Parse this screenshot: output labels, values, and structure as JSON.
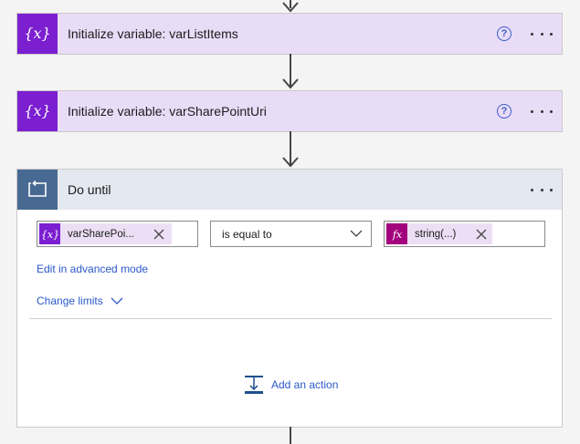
{
  "steps": [
    {
      "title": "Initialize variable: varListItems",
      "icon": "variable-icon"
    },
    {
      "title": "Initialize variable: varSharePointUri",
      "icon": "variable-icon"
    }
  ],
  "help_glyph": "?",
  "do_until": {
    "title": "Do until",
    "icon": "loop-icon",
    "condition": {
      "left_token": "varSharePoi...",
      "operator": "is equal to",
      "right_token": "string(...)"
    },
    "advanced_mode_link": "Edit in advanced mode",
    "change_limits_link": "Change limits",
    "add_action_label": "Add an action"
  },
  "colors": {
    "variable_accent": "#7b1fd1",
    "variable_header": "#e9dcf7",
    "loop_accent": "#486991",
    "loop_header": "#e4e8f0",
    "expression_accent": "#a3007d",
    "token_bg": "#ecdff5",
    "link": "#2b58c9"
  }
}
